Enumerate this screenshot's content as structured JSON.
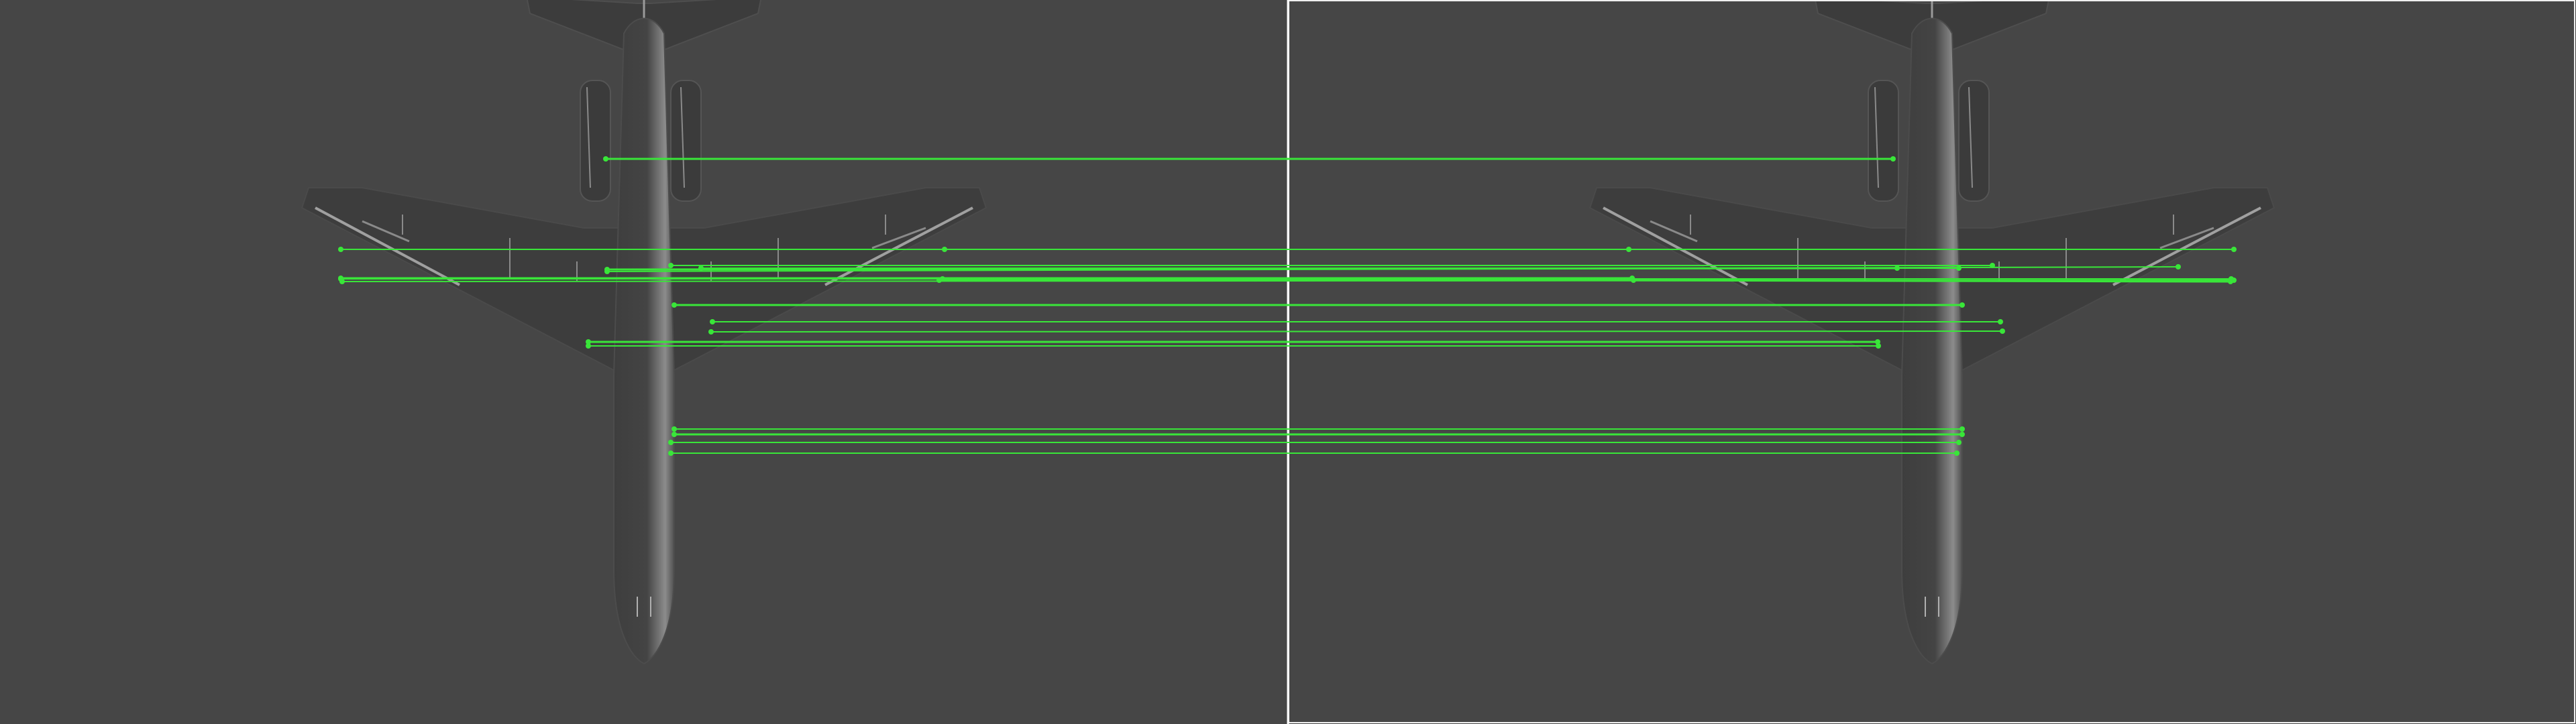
{
  "colors": {
    "background": "#464646",
    "divider": "#ffffff",
    "match_line": "#39e639",
    "aircraft_body": "#3a3a3a",
    "aircraft_highlight": "#9a9a9a"
  },
  "icons": {
    "left_view": "airplane-top-view",
    "right_view": "airplane-top-view"
  },
  "match_count": 18
}
